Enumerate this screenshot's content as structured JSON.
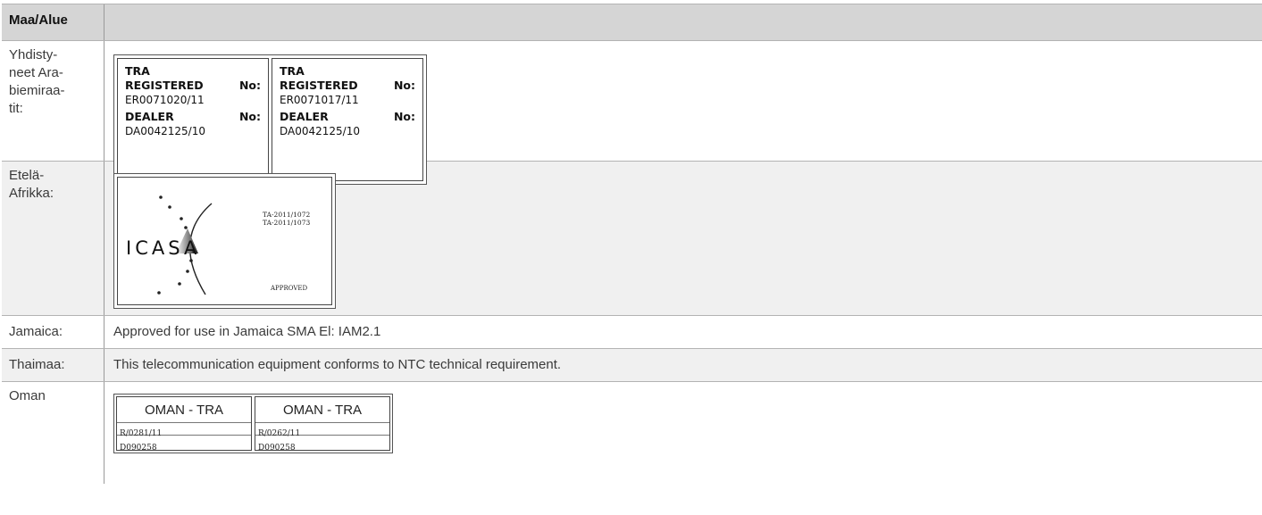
{
  "table": {
    "header": {
      "col1": "Maa/Alue",
      "col2": ""
    },
    "rows": {
      "uae": {
        "country": "Yhdisty-\nneet Ara-\nbiemiraa-\ntit:",
        "labels": [
          {
            "tra": "TRA",
            "registered": "REGISTERED",
            "no1": "No:",
            "reg_number": "ER0071020/11",
            "dealer": "DEALER",
            "no2": "No:",
            "dealer_number": "DA0042125/10"
          },
          {
            "tra": "TRA",
            "registered": "REGISTERED",
            "no1": "No:",
            "reg_number": "ER0071017/11",
            "dealer": "DEALER",
            "no2": "No:",
            "dealer_number": "DA0042125/10"
          }
        ]
      },
      "south_africa": {
        "country": "Etelä-\nAfrikka:",
        "icasa": {
          "logo_text": "ICASA",
          "number1": "TA-2011/1072",
          "number2": "TA-2011/1073",
          "approved": "APPROVED"
        }
      },
      "jamaica": {
        "country": "Jamaica:",
        "text": "Approved for use in Jamaica SMA El: IAM2.1"
      },
      "thailand": {
        "country": "Thaimaa:",
        "text": "This telecommunication equipment conforms to NTC technical requirement."
      },
      "oman": {
        "country": "Oman",
        "labels": [
          {
            "title": "OMAN - TRA",
            "reg": "R/0281/11",
            "dealer": "D090258"
          },
          {
            "title": "OMAN - TRA",
            "reg": "R/0262/11",
            "dealer": "D090258"
          }
        ]
      }
    }
  },
  "colors": {
    "header_bg": "#d5d5d5",
    "shaded_row": "#f0f0f0",
    "border": "#b3b3b3"
  }
}
